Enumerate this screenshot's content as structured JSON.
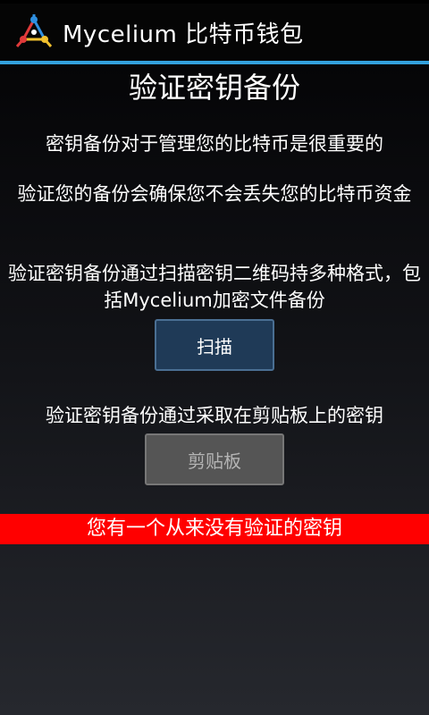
{
  "app": {
    "title": "Mycelium 比特币钱包",
    "logo_icon": "mycelium-logo-icon",
    "accent_color": "#33a1dd"
  },
  "page": {
    "title": "验证密钥备份",
    "para1": "密钥备份对于管理您的比特币是很重要的",
    "para2": "验证您的备份会确保您不会丢失您的比特币资金",
    "para3": "验证密钥备份通过扫描密钥二维码持多种格式，包括Mycelium加密文件备份",
    "para4": "验证密钥备份通过采取在剪贴板上的密钥"
  },
  "buttons": {
    "scan_label": "扫描",
    "clipboard_label": "剪贴板"
  },
  "warning": {
    "text": "您有一个从来没有验证的密钥",
    "color": "#ff0000"
  }
}
